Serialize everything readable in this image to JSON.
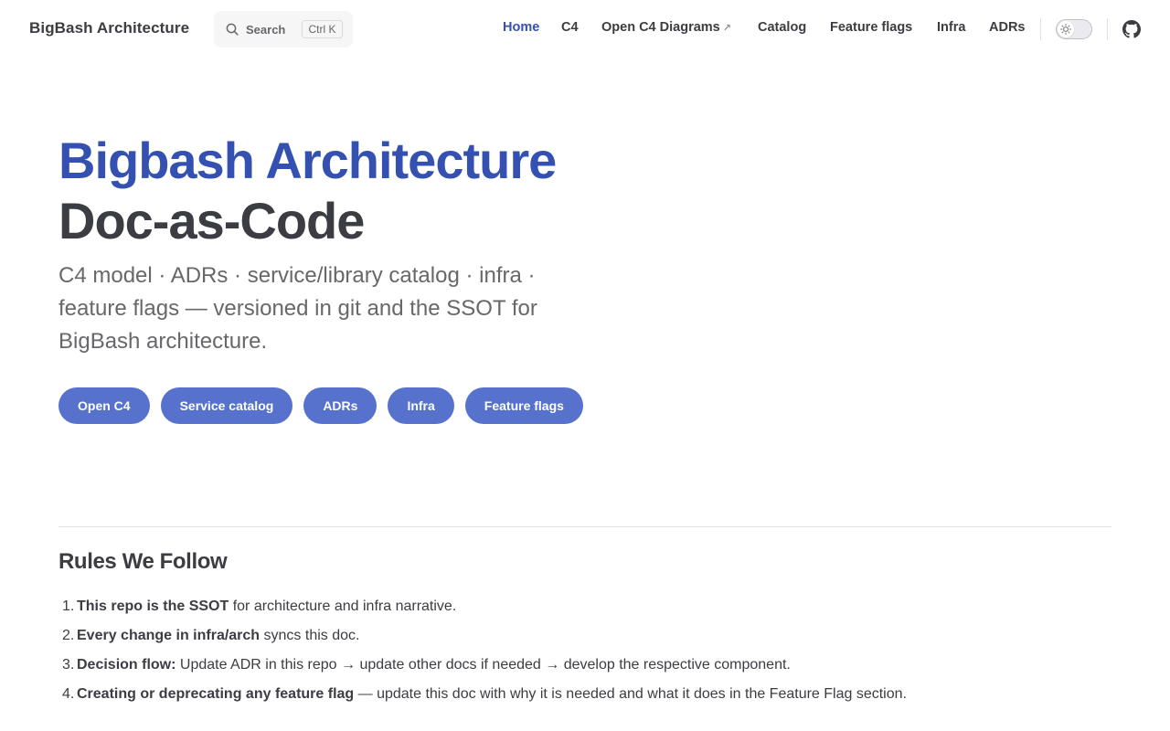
{
  "nav": {
    "site_title": "BigBash Architecture",
    "search": {
      "label": "Search",
      "shortcut": "Ctrl K"
    },
    "links": [
      {
        "label": "Home",
        "active": true
      },
      {
        "label": "C4"
      },
      {
        "label": "Open C4 Diagrams",
        "external_icon": "↗"
      },
      {
        "label": "Catalog"
      },
      {
        "label": "Feature flags"
      },
      {
        "label": "Infra"
      },
      {
        "label": "ADRs"
      }
    ]
  },
  "hero": {
    "name": "Bigbash Architecture",
    "text": "Doc-as-Code",
    "tagline": "C4 model · ADRs · service/library catalog · infra · feature flags — versioned in git and the SSOT for BigBash architecture.",
    "actions": [
      {
        "label": "Open C4"
      },
      {
        "label": "Service catalog"
      },
      {
        "label": "ADRs"
      },
      {
        "label": "Infra"
      },
      {
        "label": "Feature flags"
      }
    ]
  },
  "rules": {
    "title": "Rules We Follow",
    "items": [
      {
        "num": "1.",
        "bold": "This repo is the SSOT",
        "rest": " for architecture and infra narrative."
      },
      {
        "num": "2.",
        "bold": "Every change in infra/arch",
        "rest": " syncs this doc."
      },
      {
        "num": "3.",
        "bold": "Decision flow:",
        "rest": " Update ADR in this repo → update other docs if needed → develop the respective component."
      },
      {
        "num": "4.",
        "bold": "Creating or deprecating any feature flag",
        "rest": " — update this doc with why it is needed and what it does in the Feature Flag section."
      }
    ]
  },
  "colors": {
    "brand": "#3451b2",
    "button_bg": "#5672cd",
    "text": "#3c3c43",
    "muted": "#67676c",
    "divider": "#e2e2e3"
  },
  "icons": {
    "search": "search-icon",
    "theme_toggle": "sun-icon",
    "github": "github-icon"
  }
}
